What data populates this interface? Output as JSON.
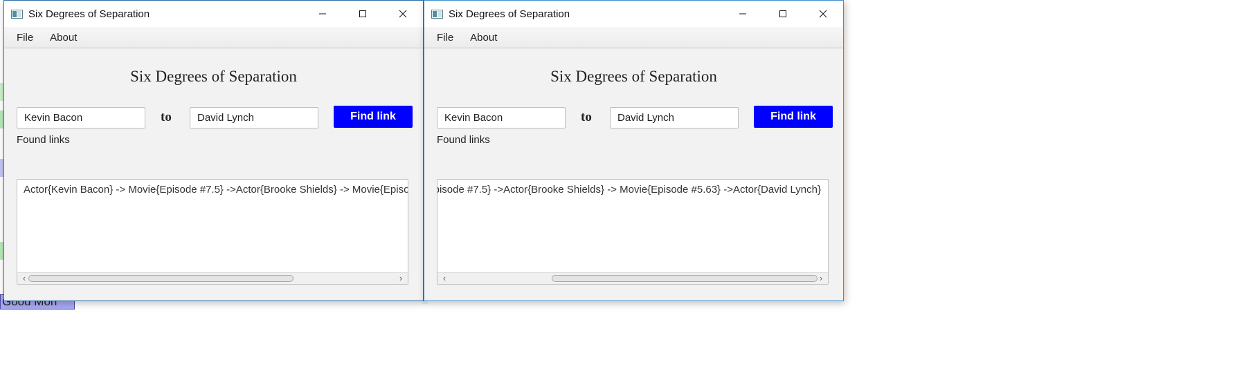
{
  "windows": [
    {
      "title": "Six Degrees of Separation",
      "menu": [
        "File",
        "About"
      ],
      "heading": "Six Degrees of Separation",
      "from_value": "Kevin Bacon",
      "connector": "to",
      "to_value": "David Lynch",
      "find_label": "Find link",
      "found_label": "Found links",
      "result_text": "Actor{Kevin Bacon} -> Movie{Episode #7.5} ->Actor{Brooke Shields} -> Movie{Episo"
    },
    {
      "title": "Six Degrees of Separation",
      "menu": [
        "File",
        "About"
      ],
      "heading": "Six Degrees of Separation",
      "from_value": "Kevin Bacon",
      "connector": "to",
      "to_value": "David Lynch",
      "find_label": "Find link",
      "found_label": "Found links",
      "result_text": "pisode #7.5} ->Actor{Brooke Shields} -> Movie{Episode #5.63} ->Actor{David Lynch}"
    }
  ],
  "background": {
    "button_text": "Good Mon"
  },
  "colors": {
    "accent_button": "#0000ff",
    "window_border_active": "#2c6fa8"
  },
  "icons": {
    "app": "app-window-icon",
    "minimize": "minimize-icon",
    "maximize": "maximize-icon",
    "close": "close-icon",
    "scroll_left": "chevron-left-icon",
    "scroll_right": "chevron-right-icon"
  }
}
